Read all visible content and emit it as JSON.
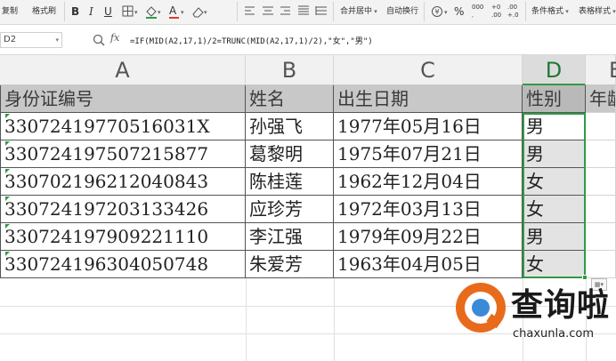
{
  "ribbon": {
    "copy_label": "复制",
    "format_painter_label": "格式刷",
    "bold_label": "B",
    "italic_label": "I",
    "underline_label": "U",
    "font_color_letter": "A",
    "merge_center_label": "合并居中",
    "wrap_text_label": "自动换行",
    "percent_label": "%",
    "thousands_label": "000",
    "inc_decimal_top": "+0",
    "inc_decimal_bottom": ".00",
    "dec_decimal_top": ".00",
    "dec_decimal_bottom": "+.0",
    "conditional_format_label": "条件格式",
    "table_style_label": "表格样式",
    "accent_color": "#2e9b47",
    "font_color": "#e03a2f"
  },
  "formula_bar": {
    "name_box": "D2",
    "fx_label": "fx",
    "formula": "=IF(MID(A2,17,1)/2=TRUNC(MID(A2,17,1)/2),\"女\",\"男\")"
  },
  "columns": [
    {
      "letter": "A",
      "active": false
    },
    {
      "letter": "B",
      "active": false
    },
    {
      "letter": "C",
      "active": false
    },
    {
      "letter": "D",
      "active": true
    },
    {
      "letter": "E",
      "active": false
    }
  ],
  "table": {
    "headers": [
      "身份证编号",
      "姓名",
      "出生日期",
      "性别",
      "年龄"
    ],
    "rows": [
      [
        "33072419770516031X",
        "孙强飞",
        "1977年05月16日",
        "男",
        ""
      ],
      [
        "330724197507215877",
        "葛黎明",
        "1975年07月21日",
        "男",
        ""
      ],
      [
        "330702196212040843",
        "陈桂莲",
        "1962年12月04日",
        "女",
        ""
      ],
      [
        "330724197203133426",
        "应珍芳",
        "1972年03月13日",
        "女",
        ""
      ],
      [
        "330724197909221110",
        "李江强",
        "1979年09月22日",
        "男",
        ""
      ],
      [
        "330724196304050748",
        "朱爱芳",
        "1963年04月05日",
        "女",
        ""
      ]
    ]
  },
  "watermark": {
    "brand": "查询啦",
    "url": "chaxunla.com",
    "orange": "#e86b1c",
    "blue": "#3a8ad9"
  }
}
